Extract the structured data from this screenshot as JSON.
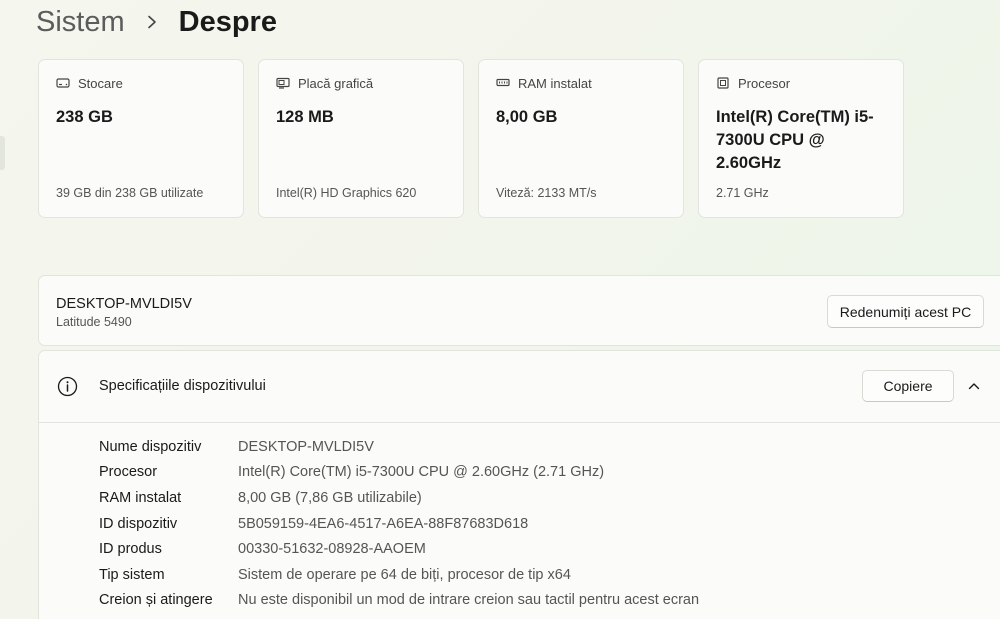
{
  "breadcrumb": {
    "parent": "Sistem",
    "current": "Despre"
  },
  "cards": [
    {
      "icon": "storage-icon",
      "title": "Stocare",
      "value": "238 GB",
      "sub": "39 GB din 238 GB utilizate"
    },
    {
      "icon": "graphics-card-icon",
      "title": "Placă grafică",
      "value": "128 MB",
      "sub": "Intel(R) HD Graphics 620"
    },
    {
      "icon": "ram-icon",
      "title": "RAM instalat",
      "value": "8,00 GB",
      "sub": "Viteză: 2133 MT/s"
    },
    {
      "icon": "processor-icon",
      "title": "Procesor",
      "value": "Intel(R) Core(TM) i5-7300U CPU @ 2.60GHz",
      "sub": "2.71 GHz"
    }
  ],
  "device": {
    "name": "DESKTOP-MVLDI5V",
    "model": "Latitude 5490",
    "rename_label": "Redenumiți acest PC"
  },
  "specs": {
    "title": "Specificațiile dispozitivului",
    "copy_label": "Copiere",
    "rows": [
      {
        "label": "Nume dispozitiv",
        "value": "DESKTOP-MVLDI5V"
      },
      {
        "label": "Procesor",
        "value": "Intel(R) Core(TM) i5-7300U CPU @ 2.60GHz (2.71 GHz)"
      },
      {
        "label": "RAM instalat",
        "value": "8,00 GB (7,86 GB utilizabile)"
      },
      {
        "label": "ID dispozitiv",
        "value": "5B059159-4EA6-4517-A6EA-88F87683D618"
      },
      {
        "label": "ID produs",
        "value": "00330-51632-08928-AAOEM"
      },
      {
        "label": "Tip sistem",
        "value": "Sistem de operare pe 64 de biți, procesor de tip x64"
      },
      {
        "label": "Creion și atingere",
        "value": "Nu este disponibil un mod de intrare creion sau tactil pentru acest ecran"
      }
    ]
  }
}
